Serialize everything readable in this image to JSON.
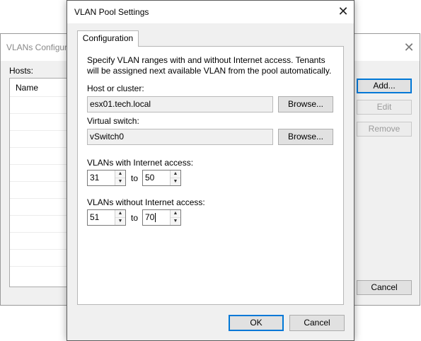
{
  "background_window": {
    "title": "VLANs Configur",
    "close_glyph": "✕",
    "hosts_label": "Hosts:",
    "list_header": "Name",
    "buttons": {
      "add": "Add...",
      "edit": "Edit",
      "remove": "Remove",
      "cancel": "Cancel"
    }
  },
  "dialog": {
    "title": "VLAN Pool Settings",
    "close_glyph": "✕",
    "tab": "Configuration",
    "description": "Specify VLAN ranges with and without Internet access. Tenants will be assigned next available VLAN from the pool automatically.",
    "host": {
      "label": "Host or cluster:",
      "value": "esx01.tech.local",
      "browse": "Browse..."
    },
    "virtual_switch": {
      "label": "Virtual switch:",
      "value": "vSwitch0",
      "browse": "Browse..."
    },
    "with_internet": {
      "label": "VLANs with Internet access:",
      "from": "31",
      "to_label": "to",
      "to": "50"
    },
    "without_internet": {
      "label": "VLANs without Internet access:",
      "from": "51",
      "to_label": "to",
      "to": "70"
    },
    "spin_up": "▲",
    "spin_down": "▼",
    "ok": "OK",
    "cancel": "Cancel"
  }
}
